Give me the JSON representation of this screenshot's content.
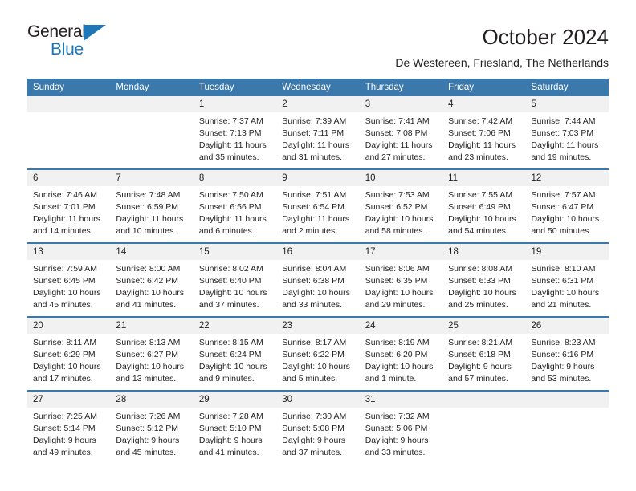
{
  "brand": {
    "name_top": "General",
    "name_bottom": "Blue",
    "accent_color": "#1f77b8"
  },
  "header": {
    "title": "October 2024",
    "subtitle": "De Westereen, Friesland, The Netherlands"
  },
  "theme": {
    "header_row_color": "#3b78ab",
    "daynum_band_color": "#f1f1f1",
    "text_color": "#231f20"
  },
  "weekday_headers": [
    "Sunday",
    "Monday",
    "Tuesday",
    "Wednesday",
    "Thursday",
    "Friday",
    "Saturday"
  ],
  "weeks": [
    [
      {
        "day": "",
        "sunrise": "",
        "sunset": "",
        "daylight_line1": "",
        "daylight_line2": "",
        "empty": true
      },
      {
        "day": "",
        "sunrise": "",
        "sunset": "",
        "daylight_line1": "",
        "daylight_line2": "",
        "empty": true
      },
      {
        "day": "1",
        "sunrise": "Sunrise: 7:37 AM",
        "sunset": "Sunset: 7:13 PM",
        "daylight_line1": "Daylight: 11 hours",
        "daylight_line2": "and 35 minutes."
      },
      {
        "day": "2",
        "sunrise": "Sunrise: 7:39 AM",
        "sunset": "Sunset: 7:11 PM",
        "daylight_line1": "Daylight: 11 hours",
        "daylight_line2": "and 31 minutes."
      },
      {
        "day": "3",
        "sunrise": "Sunrise: 7:41 AM",
        "sunset": "Sunset: 7:08 PM",
        "daylight_line1": "Daylight: 11 hours",
        "daylight_line2": "and 27 minutes."
      },
      {
        "day": "4",
        "sunrise": "Sunrise: 7:42 AM",
        "sunset": "Sunset: 7:06 PM",
        "daylight_line1": "Daylight: 11 hours",
        "daylight_line2": "and 23 minutes."
      },
      {
        "day": "5",
        "sunrise": "Sunrise: 7:44 AM",
        "sunset": "Sunset: 7:03 PM",
        "daylight_line1": "Daylight: 11 hours",
        "daylight_line2": "and 19 minutes."
      }
    ],
    [
      {
        "day": "6",
        "sunrise": "Sunrise: 7:46 AM",
        "sunset": "Sunset: 7:01 PM",
        "daylight_line1": "Daylight: 11 hours",
        "daylight_line2": "and 14 minutes."
      },
      {
        "day": "7",
        "sunrise": "Sunrise: 7:48 AM",
        "sunset": "Sunset: 6:59 PM",
        "daylight_line1": "Daylight: 11 hours",
        "daylight_line2": "and 10 minutes."
      },
      {
        "day": "8",
        "sunrise": "Sunrise: 7:50 AM",
        "sunset": "Sunset: 6:56 PM",
        "daylight_line1": "Daylight: 11 hours",
        "daylight_line2": "and 6 minutes."
      },
      {
        "day": "9",
        "sunrise": "Sunrise: 7:51 AM",
        "sunset": "Sunset: 6:54 PM",
        "daylight_line1": "Daylight: 11 hours",
        "daylight_line2": "and 2 minutes."
      },
      {
        "day": "10",
        "sunrise": "Sunrise: 7:53 AM",
        "sunset": "Sunset: 6:52 PM",
        "daylight_line1": "Daylight: 10 hours",
        "daylight_line2": "and 58 minutes."
      },
      {
        "day": "11",
        "sunrise": "Sunrise: 7:55 AM",
        "sunset": "Sunset: 6:49 PM",
        "daylight_line1": "Daylight: 10 hours",
        "daylight_line2": "and 54 minutes."
      },
      {
        "day": "12",
        "sunrise": "Sunrise: 7:57 AM",
        "sunset": "Sunset: 6:47 PM",
        "daylight_line1": "Daylight: 10 hours",
        "daylight_line2": "and 50 minutes."
      }
    ],
    [
      {
        "day": "13",
        "sunrise": "Sunrise: 7:59 AM",
        "sunset": "Sunset: 6:45 PM",
        "daylight_line1": "Daylight: 10 hours",
        "daylight_line2": "and 45 minutes."
      },
      {
        "day": "14",
        "sunrise": "Sunrise: 8:00 AM",
        "sunset": "Sunset: 6:42 PM",
        "daylight_line1": "Daylight: 10 hours",
        "daylight_line2": "and 41 minutes."
      },
      {
        "day": "15",
        "sunrise": "Sunrise: 8:02 AM",
        "sunset": "Sunset: 6:40 PM",
        "daylight_line1": "Daylight: 10 hours",
        "daylight_line2": "and 37 minutes."
      },
      {
        "day": "16",
        "sunrise": "Sunrise: 8:04 AM",
        "sunset": "Sunset: 6:38 PM",
        "daylight_line1": "Daylight: 10 hours",
        "daylight_line2": "and 33 minutes."
      },
      {
        "day": "17",
        "sunrise": "Sunrise: 8:06 AM",
        "sunset": "Sunset: 6:35 PM",
        "daylight_line1": "Daylight: 10 hours",
        "daylight_line2": "and 29 minutes."
      },
      {
        "day": "18",
        "sunrise": "Sunrise: 8:08 AM",
        "sunset": "Sunset: 6:33 PM",
        "daylight_line1": "Daylight: 10 hours",
        "daylight_line2": "and 25 minutes."
      },
      {
        "day": "19",
        "sunrise": "Sunrise: 8:10 AM",
        "sunset": "Sunset: 6:31 PM",
        "daylight_line1": "Daylight: 10 hours",
        "daylight_line2": "and 21 minutes."
      }
    ],
    [
      {
        "day": "20",
        "sunrise": "Sunrise: 8:11 AM",
        "sunset": "Sunset: 6:29 PM",
        "daylight_line1": "Daylight: 10 hours",
        "daylight_line2": "and 17 minutes."
      },
      {
        "day": "21",
        "sunrise": "Sunrise: 8:13 AM",
        "sunset": "Sunset: 6:27 PM",
        "daylight_line1": "Daylight: 10 hours",
        "daylight_line2": "and 13 minutes."
      },
      {
        "day": "22",
        "sunrise": "Sunrise: 8:15 AM",
        "sunset": "Sunset: 6:24 PM",
        "daylight_line1": "Daylight: 10 hours",
        "daylight_line2": "and 9 minutes."
      },
      {
        "day": "23",
        "sunrise": "Sunrise: 8:17 AM",
        "sunset": "Sunset: 6:22 PM",
        "daylight_line1": "Daylight: 10 hours",
        "daylight_line2": "and 5 minutes."
      },
      {
        "day": "24",
        "sunrise": "Sunrise: 8:19 AM",
        "sunset": "Sunset: 6:20 PM",
        "daylight_line1": "Daylight: 10 hours",
        "daylight_line2": "and 1 minute."
      },
      {
        "day": "25",
        "sunrise": "Sunrise: 8:21 AM",
        "sunset": "Sunset: 6:18 PM",
        "daylight_line1": "Daylight: 9 hours",
        "daylight_line2": "and 57 minutes."
      },
      {
        "day": "26",
        "sunrise": "Sunrise: 8:23 AM",
        "sunset": "Sunset: 6:16 PM",
        "daylight_line1": "Daylight: 9 hours",
        "daylight_line2": "and 53 minutes."
      }
    ],
    [
      {
        "day": "27",
        "sunrise": "Sunrise: 7:25 AM",
        "sunset": "Sunset: 5:14 PM",
        "daylight_line1": "Daylight: 9 hours",
        "daylight_line2": "and 49 minutes."
      },
      {
        "day": "28",
        "sunrise": "Sunrise: 7:26 AM",
        "sunset": "Sunset: 5:12 PM",
        "daylight_line1": "Daylight: 9 hours",
        "daylight_line2": "and 45 minutes."
      },
      {
        "day": "29",
        "sunrise": "Sunrise: 7:28 AM",
        "sunset": "Sunset: 5:10 PM",
        "daylight_line1": "Daylight: 9 hours",
        "daylight_line2": "and 41 minutes."
      },
      {
        "day": "30",
        "sunrise": "Sunrise: 7:30 AM",
        "sunset": "Sunset: 5:08 PM",
        "daylight_line1": "Daylight: 9 hours",
        "daylight_line2": "and 37 minutes."
      },
      {
        "day": "31",
        "sunrise": "Sunrise: 7:32 AM",
        "sunset": "Sunset: 5:06 PM",
        "daylight_line1": "Daylight: 9 hours",
        "daylight_line2": "and 33 minutes."
      },
      {
        "day": "",
        "sunrise": "",
        "sunset": "",
        "daylight_line1": "",
        "daylight_line2": "",
        "empty": true
      },
      {
        "day": "",
        "sunrise": "",
        "sunset": "",
        "daylight_line1": "",
        "daylight_line2": "",
        "empty": true
      }
    ]
  ]
}
